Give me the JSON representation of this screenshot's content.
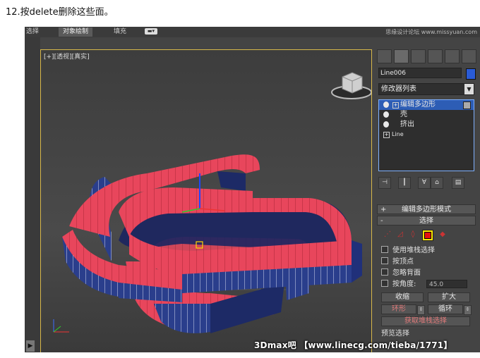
{
  "caption": "12.按delete删除这些面。",
  "tabs": [
    "选择",
    "对象绘制",
    "填充"
  ],
  "brand_text": "思缘设计论坛 www.missyuan.com",
  "viewport": {
    "label": "[+][透视][真实]"
  },
  "panel": {
    "object_name": "Line006",
    "object_color": "#2a5bd6",
    "modifier_list": "修改器列表",
    "stack": [
      {
        "label": "编辑多边形",
        "selected": true
      },
      {
        "label": "壳",
        "selected": false
      },
      {
        "label": "挤出",
        "selected": false
      },
      {
        "label": "Line",
        "selected": false
      }
    ],
    "rollout_editpoly": "编辑多边形模式",
    "rollout_select": "选择",
    "options": {
      "use_stack": "使用堆栈选择",
      "by_vertex": "按顶点",
      "ignore_back": "忽略背面",
      "by_angle": "按角度:",
      "angle_value": "45.0"
    },
    "buttons": {
      "shrink": "收缩",
      "grow": "扩大",
      "ring": "环形",
      "loop": "循环",
      "get_stack": "获取堆栈选择",
      "preview": "预览选择"
    }
  },
  "watermark": "3Dmax吧 【www.linecg.com/tieba/1771】"
}
